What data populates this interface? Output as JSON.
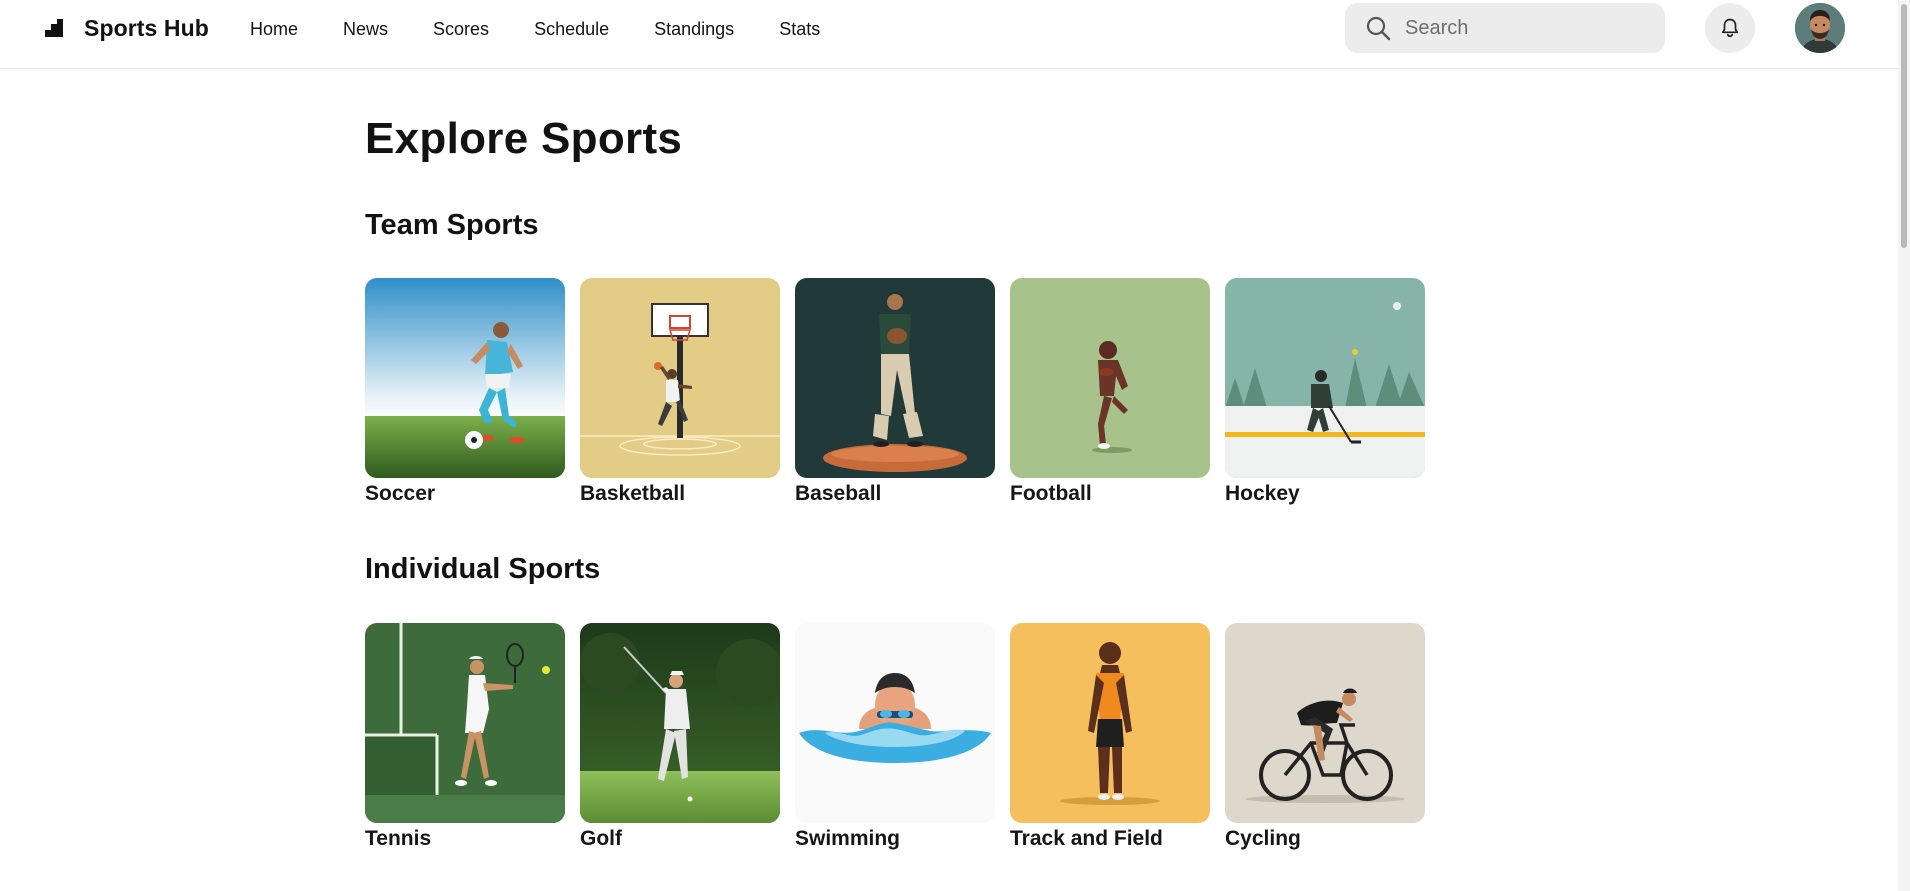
{
  "header": {
    "brand": "Sports Hub",
    "nav": [
      "Home",
      "News",
      "Scores",
      "Schedule",
      "Standings",
      "Stats"
    ],
    "search_placeholder": "Search"
  },
  "icons": {
    "logo": "bar-chart-steps-icon",
    "search": "search-icon",
    "notifications": "bell-icon"
  },
  "main": {
    "title": "Explore Sports",
    "sections": [
      {
        "title": "Team Sports",
        "cards": [
          "Soccer",
          "Basketball",
          "Baseball",
          "Football",
          "Hockey"
        ]
      },
      {
        "title": "Individual Sports",
        "cards": [
          "Tennis",
          "Golf",
          "Swimming",
          "Track and Field",
          "Cycling"
        ]
      }
    ]
  },
  "colors": {
    "search_bg": "#ececec",
    "text": "#121212",
    "basketball_bg": "#e3cc86",
    "baseball_bg": "#22393a",
    "football_bg": "#a7c28b",
    "hockey_bg": "#86b4a8",
    "tennis_bg": "#3d6b3b",
    "track_bg": "#f5bf5e",
    "cycling_bg": "#ddd7cc"
  }
}
